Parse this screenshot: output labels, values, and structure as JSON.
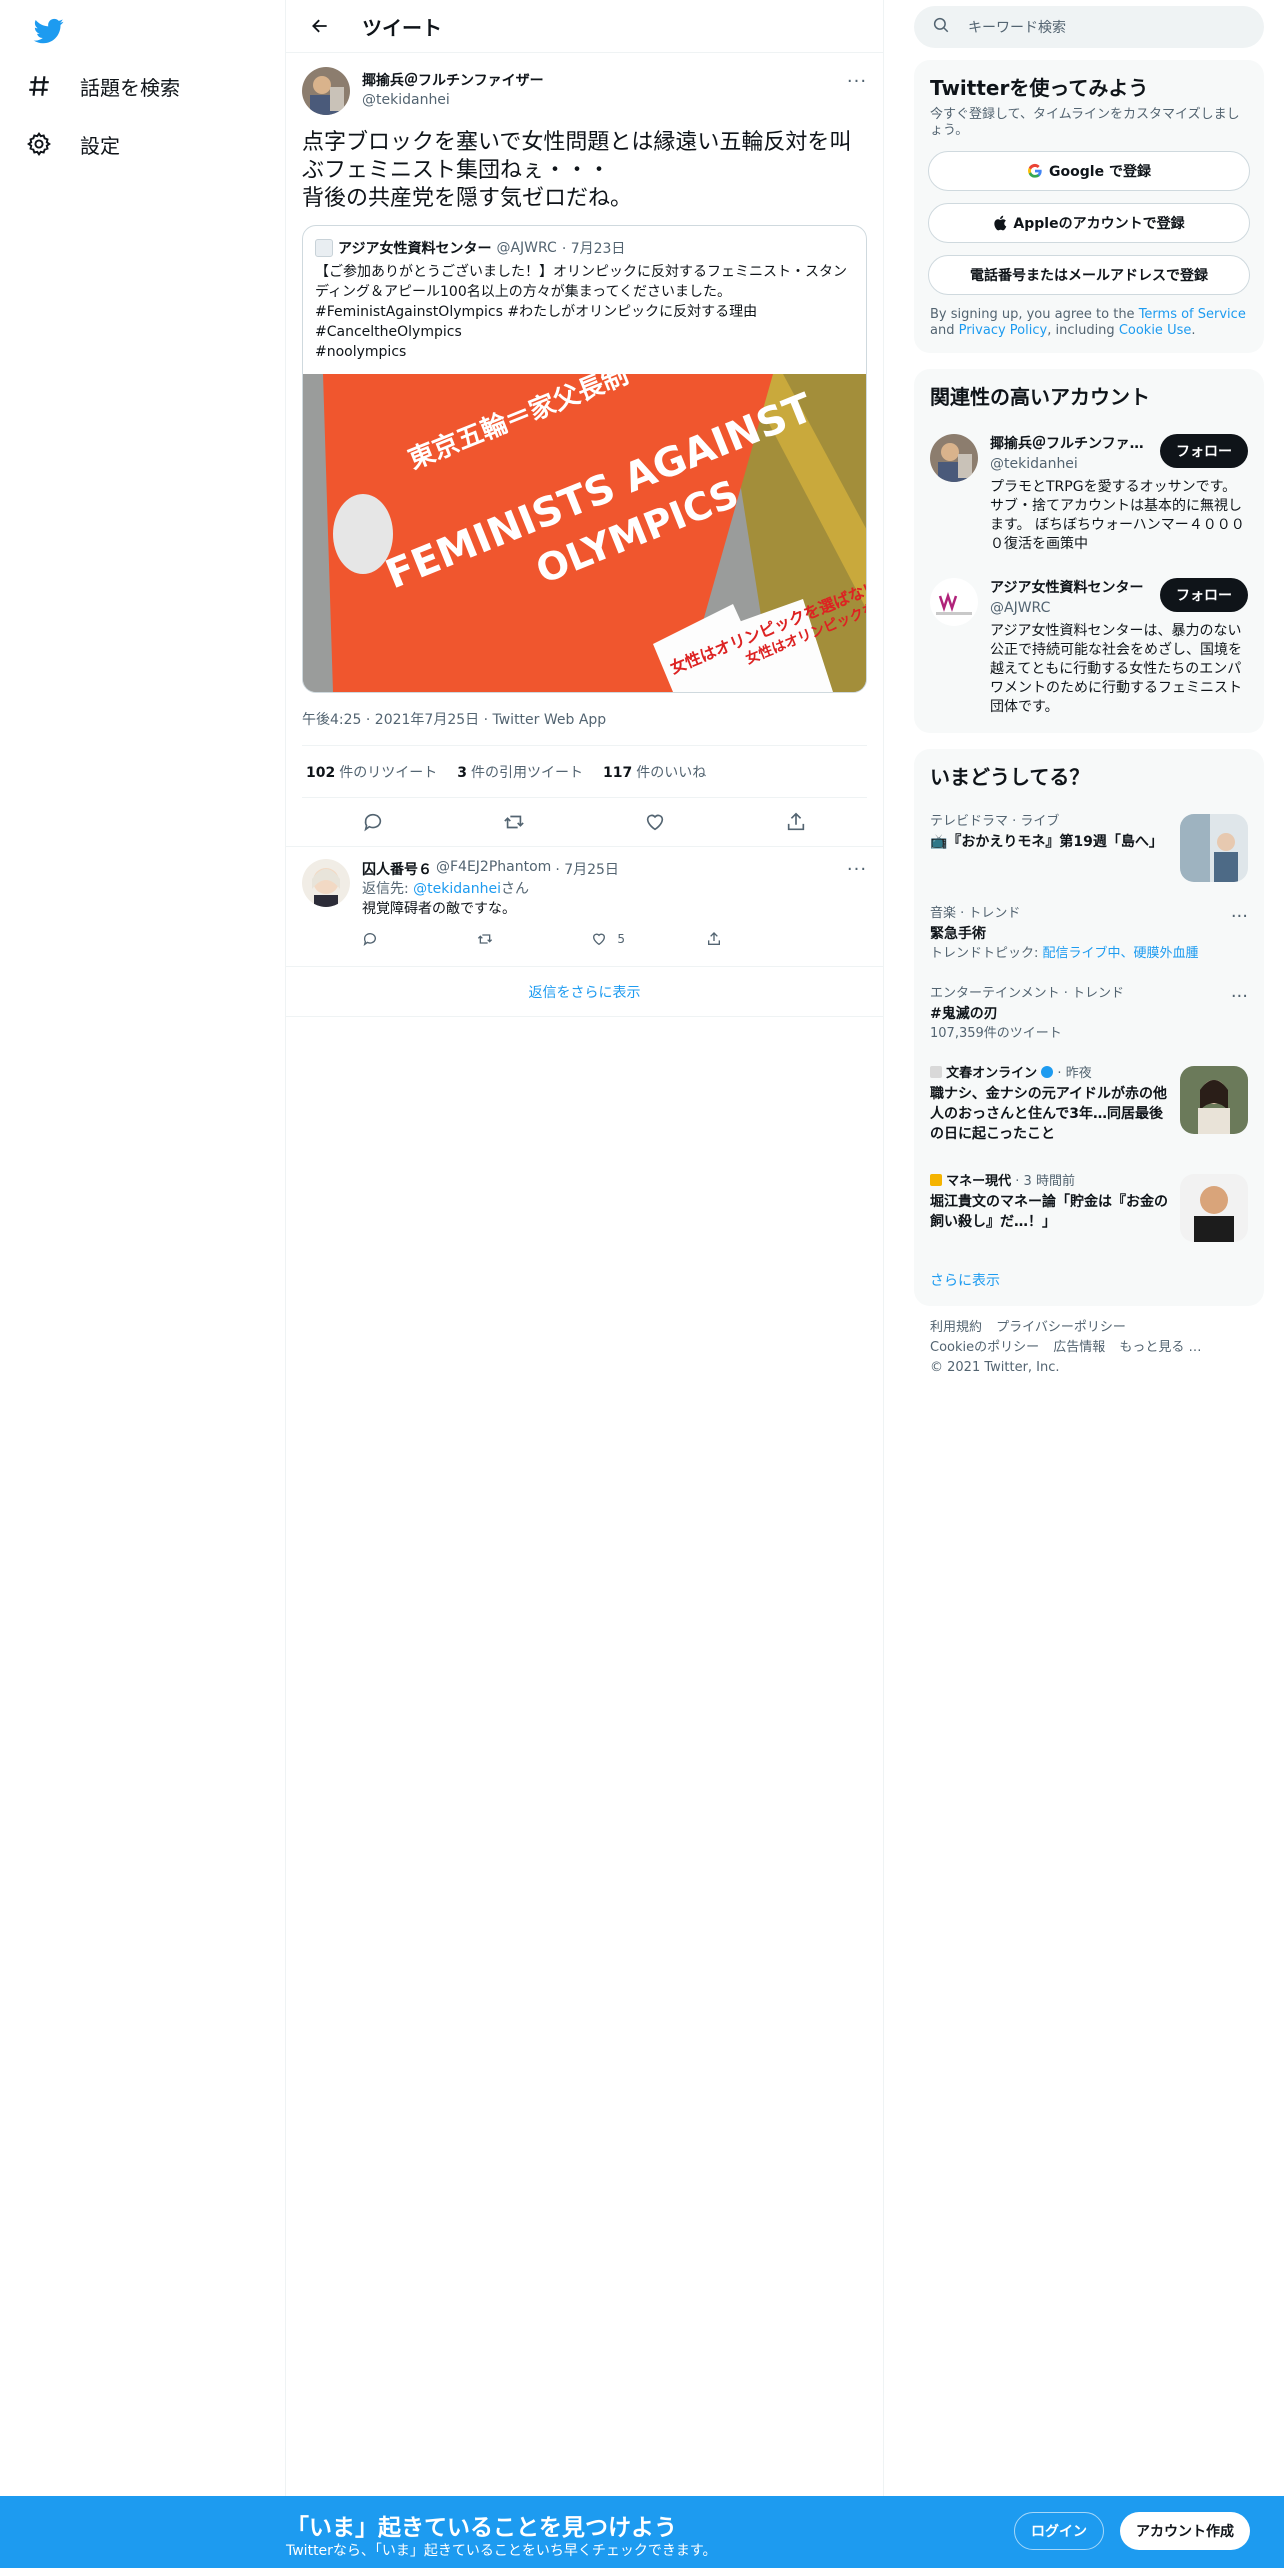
{
  "nav": {
    "logo": "twitter-bird",
    "items": [
      {
        "label": "話題を検索",
        "icon": "hashtag-icon"
      },
      {
        "label": "設定",
        "icon": "gear-icon"
      }
    ]
  },
  "header": {
    "title": "ツイート"
  },
  "tweet": {
    "author_name": "揶揄兵＠フルチンファイザー",
    "author_handle": "@tekidanhei",
    "text": "点字ブロックを塞いで女性問題とは縁遠い五輪反対を叫ぶフェミニスト集団ねぇ・・・\n背後の共産党を隠す気ゼロだね。",
    "quote": {
      "name": "アジア女性資料センター",
      "handle": "@AJWRC",
      "date": "· 7月23日",
      "text": "【ご参加ありがとうございました！】オリンピックに反対するフェミニスト・スタンディング＆アピール100名以上の方々が集まってくださいました。#FeministAgainstOlympics #わたしがオリンピックに反対する理由\n#CanceltheOlympics\n#noolympics",
      "banner_top": "東京五輪＝家父長制",
      "banner_main1": "FEMINISTS AGAINST",
      "banner_main2": "OLYMPICS",
      "sign1": "女性はオリンピックを選ばない！",
      "sign2": "女性はオリンピックを選ばない！"
    },
    "timestamp": "午後4:25 · 2021年7月25日 · Twitter Web App",
    "stats": {
      "retweets_count": "102",
      "retweets_label": "件のリツイート",
      "quotes_count": "3",
      "quotes_label": "件の引用ツイート",
      "likes_count": "117",
      "likes_label": "件のいいね"
    }
  },
  "reply": {
    "name": "囚人番号６",
    "handle": "@F4EJ2Phantom",
    "date": "· 7月25日",
    "replying_prefix": "返信先: ",
    "replying_handle": "@tekidanhei",
    "replying_suffix": "さん",
    "text": "視覚障碍者の敵ですな。",
    "likes": "5"
  },
  "show_more_replies": "返信をさらに表示",
  "search": {
    "placeholder": "キーワード検索"
  },
  "signup_card": {
    "title": "Twitterを使ってみよう",
    "subtitle": "今すぐ登録して、タイムラインをカスタマイズしましょう。",
    "google": "Google で登録",
    "apple": "Appleのアカウントで登録",
    "phone": "電話番号またはメールアドレスで登録",
    "legal_1": "By signing up, you agree to the ",
    "legal_tos": "Terms of Service",
    "legal_2": " and ",
    "legal_privacy": "Privacy Policy",
    "legal_3": ", including ",
    "legal_cookie": "Cookie Use",
    "legal_4": "."
  },
  "related": {
    "title": "関連性の高いアカウント",
    "follow_label": "フォロー",
    "accounts": [
      {
        "name": "揶揄兵＠フルチンファイザー",
        "handle": "@tekidanhei",
        "bio": "プラモとTRPGを愛するオッサンです。 サブ・捨てアカウントは基本的に無視します。 ぼちぼちウォーハンマー４００００復活を画策中"
      },
      {
        "name": "アジア女性資料センター",
        "handle": "@AJWRC",
        "bio": "アジア女性資料センターは、暴力のない公正で持続可能な社会をめざし、国境を越えてともに行動する女性たちのエンパワメントのために行動するフェミニスト団体です。"
      }
    ]
  },
  "trends": {
    "title": "いまどうしてる？",
    "items": [
      {
        "meta": "テレビドラマ · ライブ",
        "title": "📺『おかえりモネ』第19週「島へ」",
        "sub": ""
      },
      {
        "meta": "音楽 · トレンド",
        "title": "緊急手術",
        "sub_prefix": "トレンドトピック: ",
        "sub_links": "配信ライブ中、硬膜外血腫"
      },
      {
        "meta": "エンターテインメント · トレンド",
        "title": "#鬼滅の刃",
        "sub": "107,359件のツイート"
      },
      {
        "meta_name": "文春オンライン",
        "meta_time": " · 昨夜",
        "title": "職ナシ、金ナシの元アイドルが赤の他人のおっさんと住んで3年…同居最後の日に起こったこと"
      },
      {
        "meta_name": "マネー現代",
        "meta_time": " · 3 時間前",
        "title": "堀江貴文のマネー論「貯金は『お金の飼い殺し』だ…！」"
      }
    ],
    "show_more": "さらに表示"
  },
  "footer": {
    "links_row1": [
      "利用規約",
      "プライバシーポリシー"
    ],
    "links_row2": [
      "Cookieのポリシー",
      "広告情報",
      "もっと見る …"
    ],
    "copyright": "© 2021 Twitter, Inc."
  },
  "bottom_bar": {
    "title": "「いま」起きていることを見つけよう",
    "subtitle": "Twitterなら、「いま」起きていることをいち早くチェックできます。",
    "login": "ログイン",
    "signup": "アカウント作成"
  },
  "colors": {
    "brand": "#1d9bf0",
    "text": "#0f1419",
    "muted": "#536471",
    "banner_orange": "#f0562e"
  }
}
